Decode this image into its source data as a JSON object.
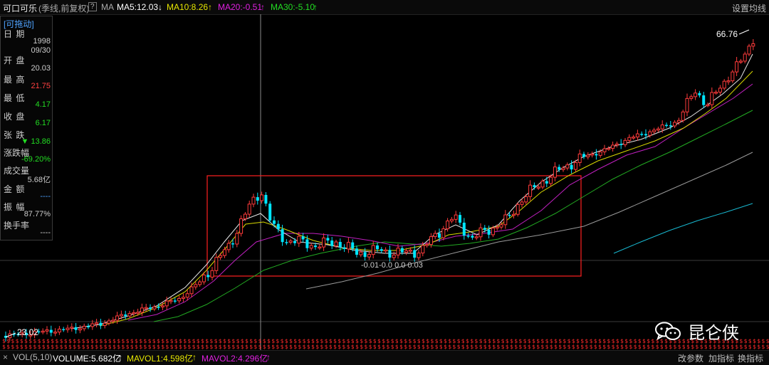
{
  "header": {
    "stock_name": "可口可乐",
    "period_type": "(季线,前复权)",
    "help_label": "?",
    "indicator": "MA",
    "ma5": "MA5:12.03",
    "ma10": "MA10:8.26",
    "ma20": "MA20:-0.51",
    "ma30": "MA30:-5.10",
    "settings_label": "设置均线",
    "arrows": {
      "ma5": "↓",
      "ma10": "↑",
      "ma20": "↑",
      "ma30": "↑"
    }
  },
  "info_panel": {
    "header": "[可拖动]",
    "date_label": "日 期",
    "date_year": "1998",
    "date_md": "09/30",
    "open_label": "开 盘",
    "open": "20.03",
    "high_label": "最 高",
    "high": "21.75",
    "low_label": "最 低",
    "low": "4.17",
    "close_label": "收 盘",
    "close": "6.17",
    "change_label": "张 跌",
    "change": "▼ 13.86",
    "change_pct_label": "涨跌幅",
    "change_pct": "-69.20%",
    "volume_label": "成交量",
    "volume": "5.68亿",
    "amount_label": "金 额",
    "amount": "----",
    "amplitude_label": "振 幅",
    "amplitude": "87.77%",
    "turnover_label": "换手率",
    "turnover": "----"
  },
  "chart_labels": {
    "max_price": "66.76",
    "min_price": "23.02",
    "dividend_labels": "-0.01-0.0 0.0 0.03"
  },
  "bottom": {
    "close_label": "×",
    "vol_label": "VOL(5,10)",
    "volume": "VOLUME:5.682亿",
    "mavol1": "MAVOL1:4.598亿",
    "mavol2": "MAVOL2:4.296亿",
    "arrows": {
      "volume": "↑",
      "mavol1": "↑",
      "mavol2": "↑"
    },
    "btn_params": "改参数",
    "btn_add": "加指标",
    "btn_switch": "换指标"
  },
  "watermark": {
    "text": "昆仑侠",
    "icon": "wechat-icon"
  },
  "colors": {
    "up": "#ff3b3b",
    "down": "#00e5ff",
    "ma5": "#ffffff",
    "ma10": "#e6e600",
    "ma20": "#e020e0",
    "ma30": "#22dd22",
    "highlight_box": "#ff2020"
  }
}
